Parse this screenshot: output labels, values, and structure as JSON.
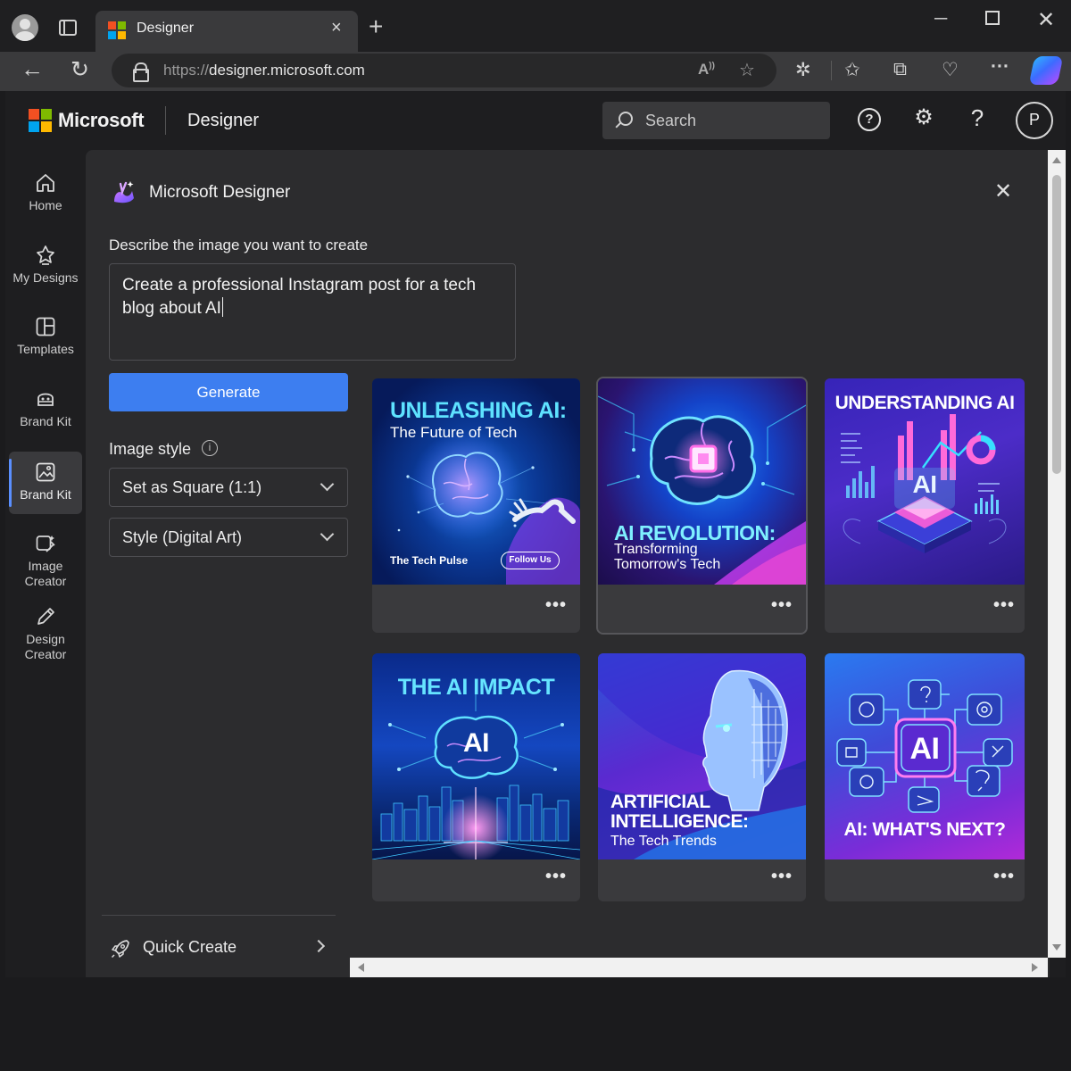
{
  "browser": {
    "tab_title": "Designer",
    "url_scheme": "https://",
    "url_host": "designer.microsoft.com",
    "icons": [
      "profile-icon",
      "tab-actions-icon",
      "close-tab-icon",
      "new-tab-icon",
      "minimize-icon",
      "maximize-icon",
      "close-window-icon",
      "back-icon",
      "refresh-icon",
      "lock-icon",
      "read-aloud-icon",
      "favorite-icon",
      "extensions-icon",
      "favorites-icon",
      "collections-icon",
      "browser-essentials-icon",
      "more-icon",
      "copilot-icon"
    ]
  },
  "header": {
    "brand": "Microsoft",
    "product": "Designer",
    "search_placeholder": "Search",
    "help_glyph": "?",
    "avatar_initial": "P"
  },
  "rail": {
    "items": [
      {
        "label": "Home",
        "icon": "home-icon"
      },
      {
        "label": "My Designs",
        "icon": "my-designs-icon"
      },
      {
        "label": "Templates",
        "icon": "templates-icon"
      },
      {
        "label": "Brand Kit",
        "icon": "brand-kit-icon"
      },
      {
        "label": "Brand Kit",
        "icon": "image-icon",
        "active": true
      },
      {
        "label": "Image Creator",
        "icon": "image-creator-icon"
      },
      {
        "label": "Design Creator",
        "icon": "pencil-icon"
      }
    ]
  },
  "panel": {
    "title": "Microsoft Designer",
    "prompt_label": "Describe the image you want to create",
    "prompt_value": "Create a professional Instagram post for a tech blog about AI",
    "generate_label": "Generate",
    "image_style_label": "Image style",
    "info_glyph": "i",
    "size_value": "Set as Square (1:1)",
    "style_value": "Style (Digital Art)",
    "quick_create_label": "Quick Create"
  },
  "gallery": [
    {
      "title": "UNLEASHING AI:",
      "subtitle": "The Future of Tech",
      "footer_left": "The Tech Pulse",
      "footer_button": "Follow Us"
    },
    {
      "title": "AI REVOLUTION:",
      "subtitle": "Transforming",
      "subtitle2": "Tomorrow's Tech",
      "selected": true
    },
    {
      "title": "UNDERSTANDING AI",
      "center": "AI"
    },
    {
      "title": "THE AI IMPACT",
      "center": "AI"
    },
    {
      "title": "ARTIFICIAL",
      "title2": "INTELLIGENCE:",
      "subtitle": "The Tech Trends"
    },
    {
      "title": "AI: WHAT'S NEXT?",
      "center": "AI"
    }
  ],
  "more_glyph": "•••",
  "colors": {
    "accent": "#3d7ef0",
    "panel_bg": "#2c2c2e",
    "card_bg": "#3a3a3d",
    "neon_cyan": "#28d8ff",
    "neon_magenta": "#e23dff"
  }
}
